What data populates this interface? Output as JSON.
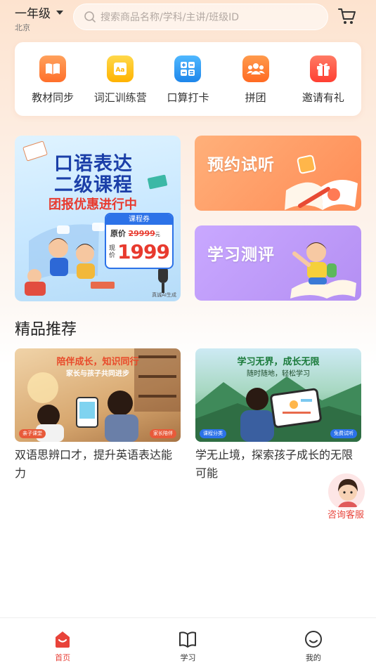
{
  "header": {
    "grade": "一年级",
    "city": "北京",
    "search_placeholder": "搜索商品名称/学科/主讲/班级ID"
  },
  "quick_menu": [
    {
      "label": "教材同步",
      "icon": "book-icon",
      "color": "#ff7f3a"
    },
    {
      "label": "词汇训练营",
      "icon": "vocabulary-icon",
      "color": "#ffc21a"
    },
    {
      "label": "口算打卡",
      "icon": "calculator-icon",
      "color": "#2a9df4"
    },
    {
      "label": "拼团",
      "icon": "group-icon",
      "color": "#ff7a32"
    },
    {
      "label": "邀请有礼",
      "icon": "gift-icon",
      "color": "#ff5140"
    }
  ],
  "banners": {
    "main": {
      "title_line1": "口语表达",
      "title_line2": "二级课程",
      "subtitle": "团报优惠进行中",
      "coupon_label": "课程券",
      "original_label": "原价",
      "original_price": "29999",
      "original_unit": "元",
      "now_label": "现价",
      "now_price": "1999",
      "watermark": "真诚AI生成"
    },
    "trial": {
      "title": "预约试听"
    },
    "assessment": {
      "title": "学习测评"
    }
  },
  "section": {
    "title": "精品推荐"
  },
  "cards": [
    {
      "image_heading": "陪伴成长，知识同行",
      "image_sub": "家长与孩子共同进步",
      "tag_left": "亲子课堂",
      "tag_right": "家长陪伴",
      "title": "双语思辨口才，提升英语表达能力"
    },
    {
      "image_heading": "学习无界，成长无限",
      "image_sub": "随时随地，轻松学习",
      "tag_left": "课程分类",
      "tag_right": "免费试听",
      "title": "学无止境，探索孩子成长的无限可能"
    }
  ],
  "service": {
    "label": "咨询客服"
  },
  "tabbar": [
    {
      "label": "首页",
      "icon": "home-icon",
      "active": true
    },
    {
      "label": "学习",
      "icon": "study-book-icon",
      "active": false
    },
    {
      "label": "我的",
      "icon": "profile-smile-icon",
      "active": false
    }
  ],
  "colors": {
    "accent": "#e8433a",
    "brand_orange": "#ff7f3a"
  }
}
